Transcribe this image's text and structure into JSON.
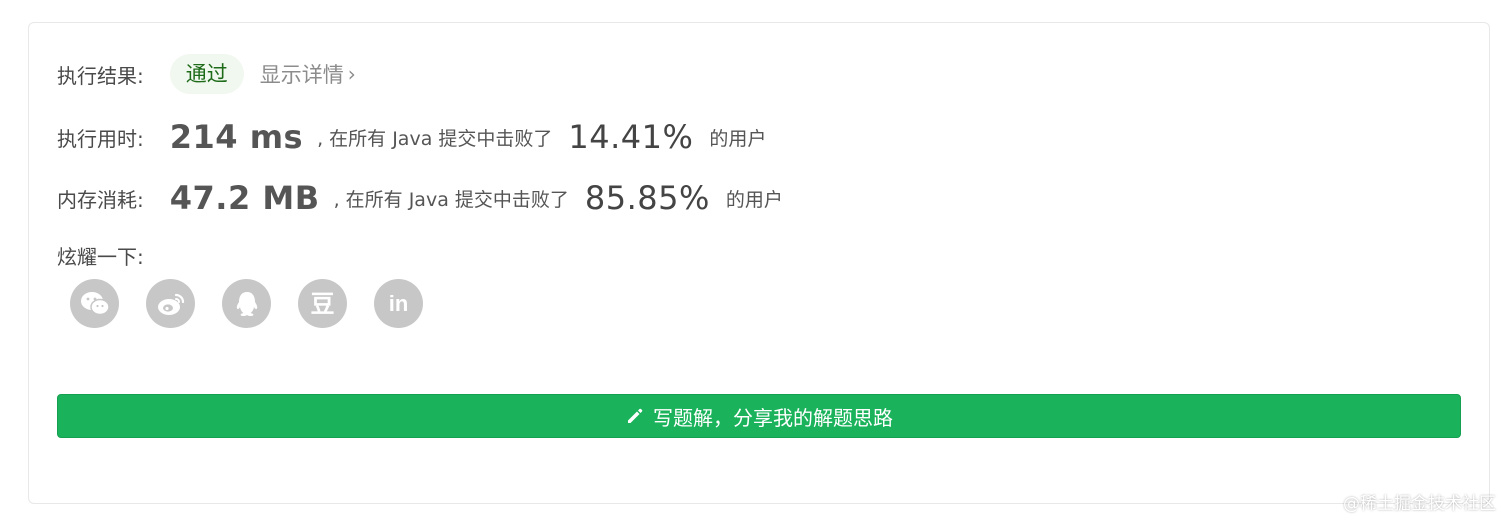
{
  "result": {
    "label": "执行结果:",
    "status": "通过",
    "details_link": "显示详情",
    "chevron": "›"
  },
  "runtime": {
    "label": "执行用时:",
    "value": "214 ms",
    "prefix": ", 在所有 Java 提交中击败了",
    "percent": "14.41%",
    "suffix": "的用户"
  },
  "memory": {
    "label": "内存消耗:",
    "value": "47.2 MB",
    "prefix": ", 在所有 Java 提交中击败了",
    "percent": "85.85%",
    "suffix": "的用户"
  },
  "share": {
    "label": "炫耀一下:",
    "icons": [
      "wechat-icon",
      "weibo-icon",
      "qq-icon",
      "douban-icon",
      "linkedin-icon"
    ],
    "douban_glyph": "豆",
    "linkedin_glyph": "in"
  },
  "action": {
    "label": "写题解，分享我的解题思路",
    "icon": "pencil-icon"
  },
  "watermark": "@稀土掘金技术社区",
  "colors": {
    "accent_green": "#1ab35c",
    "pill_bg": "#f1f8ef",
    "icon_gray": "#c7c7c7"
  }
}
